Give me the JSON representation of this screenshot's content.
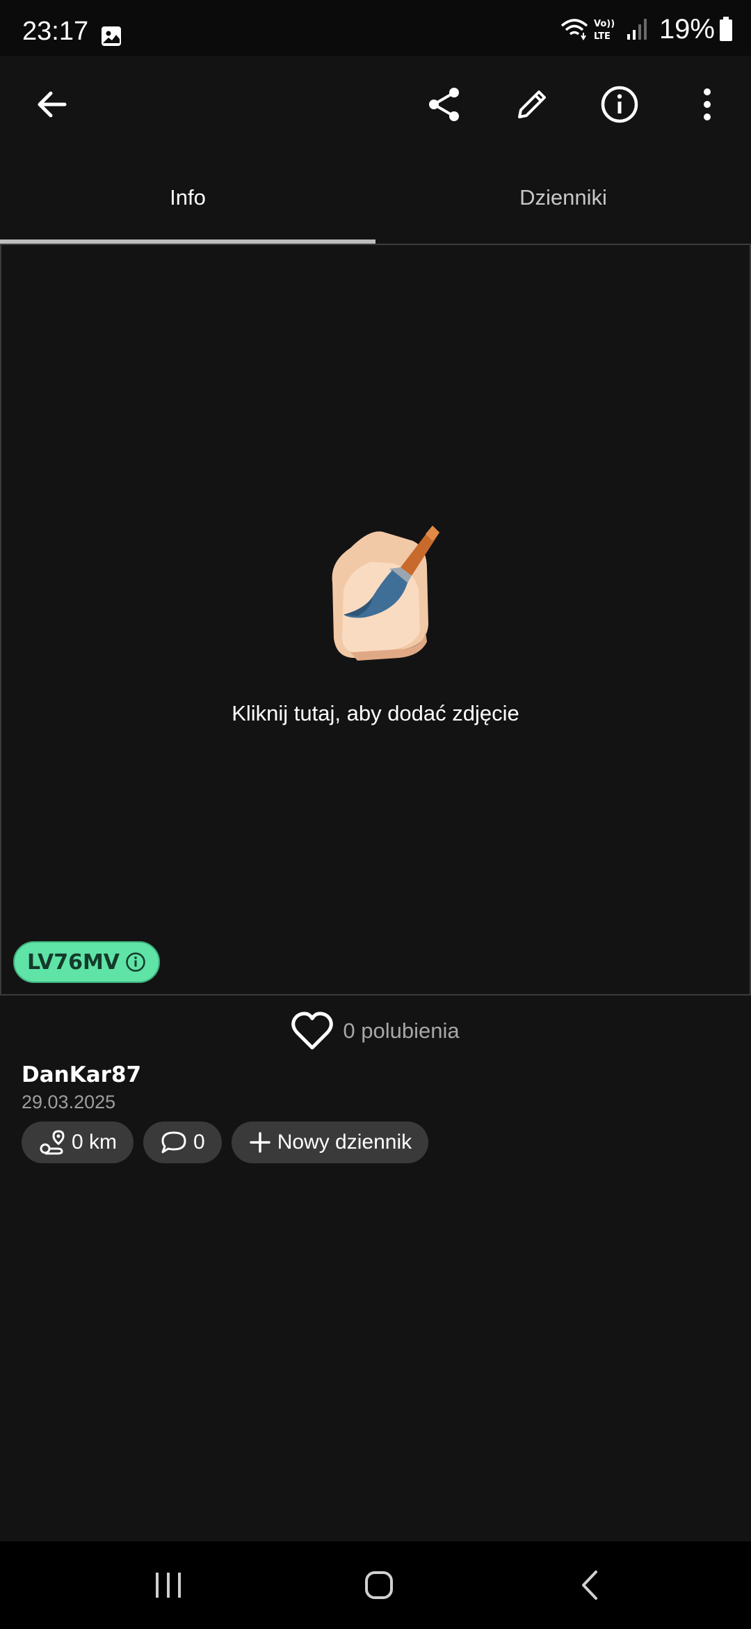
{
  "status_bar": {
    "time": "23:17",
    "battery": "19%",
    "icons": [
      "gallery-icon",
      "wifi-icon",
      "volte-icon",
      "signal-icon",
      "battery-icon"
    ]
  },
  "app_bar": {
    "icons": [
      "back-arrow-icon",
      "share-icon",
      "pencil-icon",
      "info-icon",
      "more-vertical-icon"
    ]
  },
  "tabs": [
    {
      "label": "Info",
      "active": true
    },
    {
      "label": "Dzienniki",
      "active": false
    }
  ],
  "photo": {
    "hint": "Kliknij tutaj, aby dodać zdjęcie",
    "icon": "painting-hand-icon"
  },
  "plate": {
    "number": "LV76MV",
    "color": "#5fe3a7"
  },
  "likes": {
    "count": "0",
    "label": "polubienia"
  },
  "entry": {
    "author": "DanKar87",
    "date": "29.03.2025"
  },
  "chips": {
    "distance": "0 km",
    "comments": "0",
    "new_log": "Nowy dziennik"
  },
  "nav_bar": {
    "icons": [
      "recent-apps-icon",
      "home-icon",
      "back-icon"
    ]
  }
}
